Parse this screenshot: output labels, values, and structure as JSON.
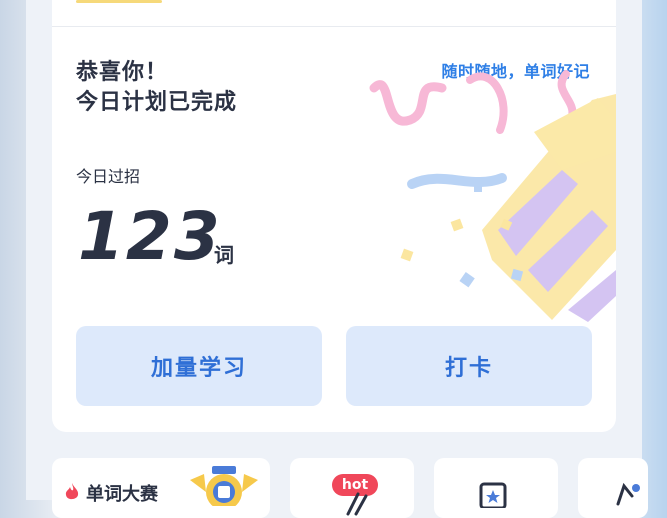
{
  "card": {
    "congrats_line1": "恭喜你！",
    "congrats_line2": "今日计划已完成",
    "slogan": "随时随地，单词好记",
    "today_label": "今日过招",
    "word_count": "123",
    "word_unit": "词"
  },
  "actions": {
    "add_study_label": "加量学习",
    "checkin_label": "打卡"
  },
  "bottom": {
    "contest_label": "单词大赛",
    "hot_badge": "hot"
  },
  "icons": [
    "confetti-popper-icon",
    "flame-icon",
    "medal-icon",
    "star-card-icon"
  ],
  "colors": {
    "accent": "#2f7fe6",
    "button_bg": "#dde9fb",
    "hot": "#f0475a",
    "text": "#2b3244"
  }
}
